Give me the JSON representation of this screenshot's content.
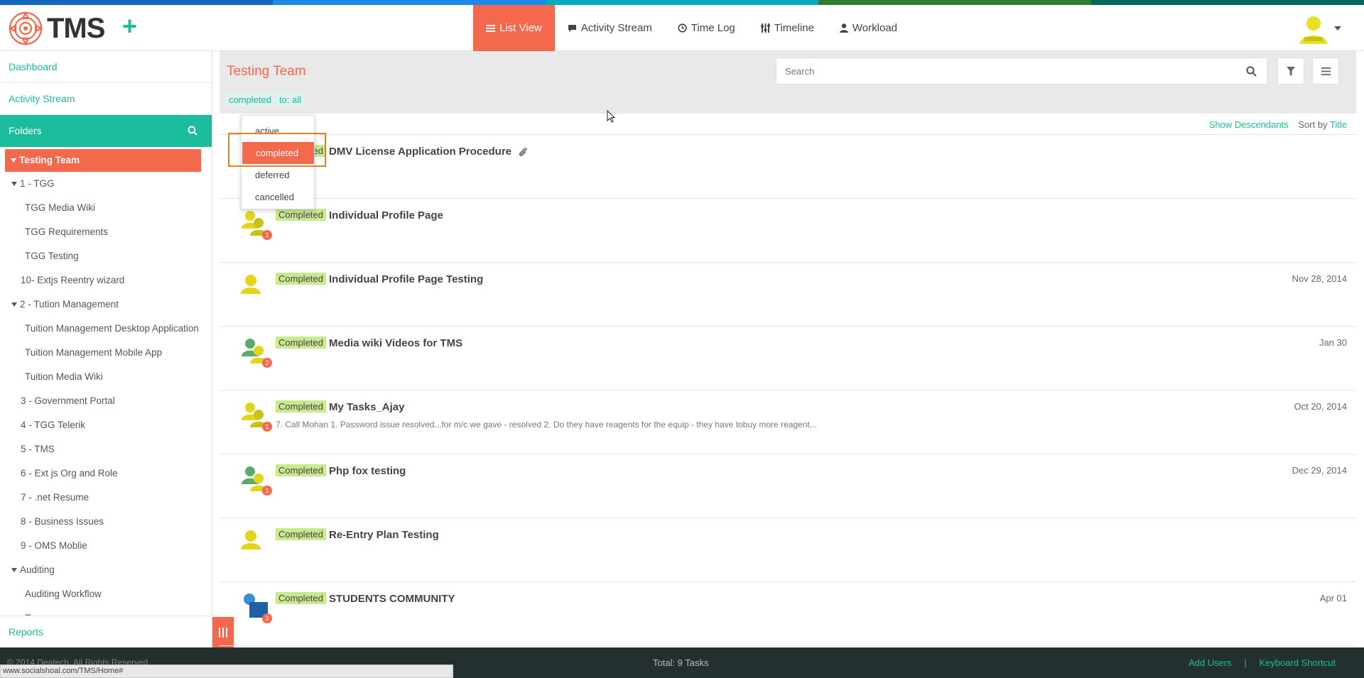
{
  "colors": {
    "accent": "#f4684d",
    "teal": "#1bbc9b",
    "status_bg": "#c9e88f",
    "stripe": [
      "#1565c0",
      "#1e88e5",
      "#00acc1",
      "#2e7d32",
      "#00695c"
    ]
  },
  "header": {
    "logo_text": "TMS",
    "plus_icon": "plus-icon",
    "nav": [
      {
        "label": "List View",
        "icon": "list-icon",
        "active": true
      },
      {
        "label": "Activity Stream",
        "icon": "comment-icon"
      },
      {
        "label": "Time Log",
        "icon": "clock-icon"
      },
      {
        "label": "Timeline",
        "icon": "sliders-icon"
      },
      {
        "label": "Workload",
        "icon": "user-icon"
      }
    ]
  },
  "sidebar": {
    "dashboard": "Dashboard",
    "activity_stream": "Activity Stream",
    "folders_label": "Folders",
    "tree": [
      {
        "label": "Testing Team",
        "caret": true,
        "selected": true
      },
      {
        "label": "1 - TGG",
        "caret": true
      },
      {
        "label": "TGG Media Wiki"
      },
      {
        "label": "TGG Requirements"
      },
      {
        "label": "TGG Testing"
      },
      {
        "label": "10- Extjs Reentry wizard"
      },
      {
        "label": "2 - Tution Management",
        "caret": true
      },
      {
        "label": "Tuition Management Desktop Application"
      },
      {
        "label": "Tuition Management Mobile App"
      },
      {
        "label": "Tuition Media Wiki"
      },
      {
        "label": "3 - Government Portal"
      },
      {
        "label": "4 - TGG Telerik"
      },
      {
        "label": "5 - TMS"
      },
      {
        "label": "6 - Ext js Org and Role"
      },
      {
        "label": "7 - .net Resume"
      },
      {
        "label": "8 - Business Issues"
      },
      {
        "label": "9 - OMS Moblie"
      },
      {
        "label": "Auditing",
        "caret": true
      },
      {
        "label": "Auditing Workflow"
      },
      {
        "label": "E..."
      }
    ],
    "reports": "Reports"
  },
  "main": {
    "title": "Testing Team",
    "search_placeholder": "Search",
    "filter_status": "completed",
    "filter_to": "to: all",
    "show_descendants": "Show Descendants",
    "sort_by": "Sort by",
    "sort_field": "Title"
  },
  "dropdown": [
    "active",
    "completed",
    "deferred",
    "cancelled"
  ],
  "tasks": [
    {
      "status": "Completed",
      "title": "DMV License Application Procedure",
      "date": "",
      "desc": "",
      "badge": "",
      "attach": true,
      "avatar": "yellow"
    },
    {
      "status": "Completed",
      "title": "Individual Profile Page",
      "date": "",
      "desc": "",
      "badge": "1",
      "avatar": "yellow-multi"
    },
    {
      "status": "Completed",
      "title": "Individual Profile Page Testing",
      "date": "Nov 28, 2014",
      "desc": "",
      "badge": "",
      "avatar": "yellow"
    },
    {
      "status": "Completed",
      "title": "Media wiki Videos for TMS",
      "date": "Jan 30",
      "desc": "",
      "badge": "2",
      "avatar": "green-multi"
    },
    {
      "status": "Completed",
      "title": "My Tasks_Ajay",
      "date": "Oct 20, 2014",
      "desc": "7. Call Mohan 1. Password issue resolved...for m/c we gave - resolved 2. Do they have reagents for the equip - they have tobuy more reagent...",
      "badge": "1",
      "avatar": "yellow-multi"
    },
    {
      "status": "Completed",
      "title": "Php fox testing",
      "date": "Dec 29, 2014",
      "desc": "",
      "badge": "1",
      "avatar": "green-multi"
    },
    {
      "status": "Completed",
      "title": "Re-Entry Plan Testing",
      "date": "",
      "desc": "",
      "badge": "",
      "avatar": "yellow"
    },
    {
      "status": "Completed",
      "title": "STUDENTS COMMUNITY",
      "date": "Apr 01",
      "desc": "",
      "badge": "3",
      "avatar": "blue-multi"
    }
  ],
  "footer": {
    "copyright": "© 2014 Deatech. All Rights Reserved",
    "total": "Total: 9 Tasks",
    "add_users": "Add Users",
    "separator": "|",
    "keyboard_shortcut": "Keyboard Shortcut"
  },
  "statusbar_url": "www.socialshoal.com/TMS/Home#"
}
